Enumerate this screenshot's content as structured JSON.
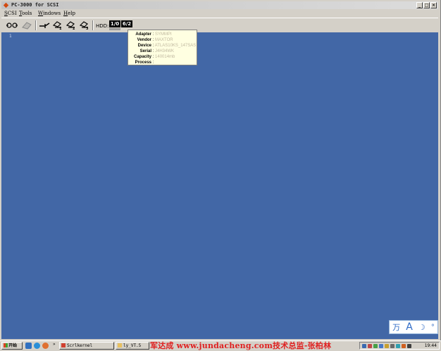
{
  "window": {
    "title": "PC-3000 for SCSI",
    "controls": [
      "_",
      "□",
      "×"
    ]
  },
  "menu": {
    "items": [
      "SCSI",
      "Tools",
      "Windows",
      "Help"
    ]
  },
  "toolbar": {
    "hdd_label": "HDD:",
    "hdd_tabs": [
      "1/0",
      "6/2"
    ],
    "icon_subscripts": [
      "1",
      "2",
      "3"
    ]
  },
  "workspace": {
    "mark": "1"
  },
  "tooltip": {
    "rows": [
      {
        "key": "Adapter",
        "value": "SYMMPI"
      },
      {
        "key": "Vendor",
        "value": "MAXTOR"
      },
      {
        "key": "Device",
        "value": "ATLAS10KS_147SAS"
      },
      {
        "key": "Serial",
        "value": "J4H34WK"
      },
      {
        "key": "Capacity",
        "value": "140014mb"
      },
      {
        "key": "Process",
        "value": ""
      }
    ]
  },
  "ime": {
    "glyphs": [
      "万",
      "A",
      "☽",
      "°"
    ]
  },
  "taskbar": {
    "start_label": "开始",
    "tasks": [
      "Scrlkernel",
      "ly_VT.5"
    ],
    "watermark": "军达成 www.jundacheng.com技术总监-张柏林",
    "clock": "19:44"
  },
  "colors": {
    "workspace_bg": "#4267a6",
    "tooltip_bg": "#ffffe1",
    "watermark": "#e02020"
  }
}
